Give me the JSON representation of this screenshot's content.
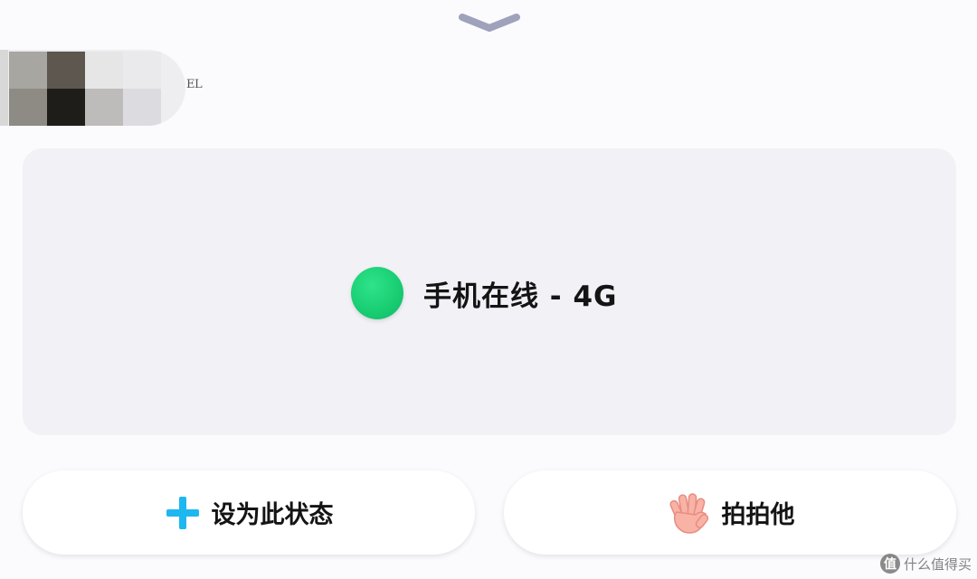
{
  "header": {
    "collapse_icon": "chevron-down-icon"
  },
  "user": {
    "avatar_icon": "pixelated-avatar",
    "name_fragment": "EL",
    "mosaic_colors": [
      "#a8a6a1",
      "#5e574f",
      "#e6e6e7",
      "#eaeaec",
      "#8e8a84",
      "#1f1d19",
      "#bdbcbb",
      "#dcdce0"
    ]
  },
  "status": {
    "indicator_color": "#1fd67c",
    "label": "手机在线 - 4G"
  },
  "actions": {
    "set_status": {
      "icon": "plus-icon",
      "icon_color": "#1eb7f0",
      "label": "设为此状态"
    },
    "nudge": {
      "icon": "waving-hand-icon",
      "label": "拍拍他"
    }
  },
  "watermark": {
    "badge": "值",
    "text": "什么值得买"
  }
}
